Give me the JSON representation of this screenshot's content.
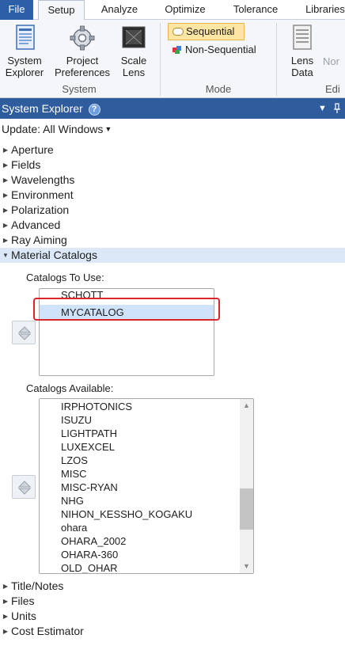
{
  "ribbon": {
    "tabs": [
      "File",
      "Setup",
      "Analyze",
      "Optimize",
      "Tolerance",
      "Libraries"
    ],
    "active_tab": "Setup",
    "system_group": {
      "label": "System",
      "buttons": [
        {
          "label_line1": "System",
          "label_line2": "Explorer",
          "icon": "system-explorer-icon"
        },
        {
          "label_line1": "Project",
          "label_line2": "Preferences",
          "icon": "gear-icon"
        },
        {
          "label_line1": "Scale",
          "label_line2": "Lens",
          "icon": "scale-lens-icon"
        }
      ]
    },
    "mode_group": {
      "label": "Mode",
      "sequential": "Sequential",
      "non_sequential": "Non-Sequential",
      "selected": "Sequential"
    },
    "edit_group": {
      "label_partial": "Edi",
      "lens_data_line1": "Lens",
      "lens_data_line2": "Data",
      "non_partial": "Nor"
    }
  },
  "system_explorer": {
    "title": "System Explorer",
    "help_glyph": "?",
    "update_label": "Update: All Windows",
    "tree_items": [
      "Aperture",
      "Fields",
      "Wavelengths",
      "Environment",
      "Polarization",
      "Advanced",
      "Ray Aiming"
    ],
    "expanded_item": "Material Catalogs",
    "catalogs_to_use_label": "Catalogs To Use:",
    "catalogs_to_use": [
      "SCHOTT",
      "MYCATALOG"
    ],
    "selected_catalog": "MYCATALOG",
    "catalogs_available_label": "Catalogs Available:",
    "catalogs_available": [
      "IRPHOTONICS",
      "ISUZU",
      "LIGHTPATH",
      "LUXEXCEL",
      "LZOS",
      "MISC",
      "MISC-RYAN",
      "NHG",
      "NIHON_KESSHO_KOGAKU",
      "ohara",
      "OHARA_2002",
      "OHARA-360",
      "OLD_OHAR"
    ],
    "available_scroll_fraction": 0.72,
    "tree_items_after": [
      "Title/Notes",
      "Files",
      "Units",
      "Cost Estimator"
    ]
  },
  "colors": {
    "header_blue": "#2e5c9c",
    "file_tab_blue": "#2d5ea8",
    "selected_row": "#cfe3fa",
    "annotation_red": "#d7272b"
  }
}
